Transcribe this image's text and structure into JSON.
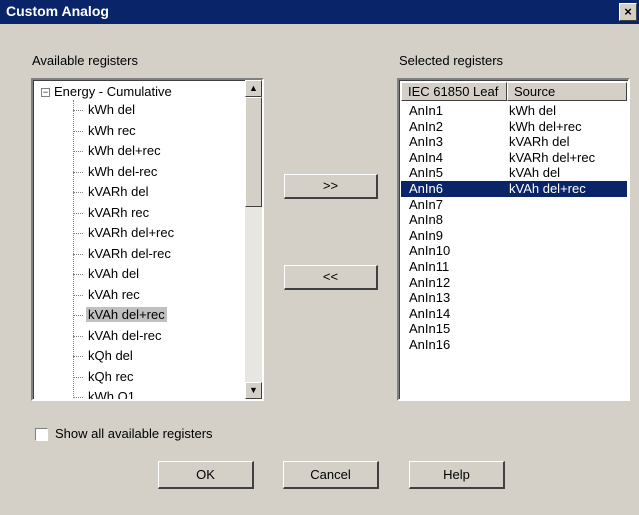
{
  "window": {
    "title": "Custom Analog",
    "close_label": "×"
  },
  "available": {
    "label": "Available registers",
    "root": {
      "expander": "−",
      "label": "Energy - Cumulative"
    },
    "items": [
      {
        "label": "kWh del"
      },
      {
        "label": "kWh rec"
      },
      {
        "label": "kWh del+rec"
      },
      {
        "label": "kWh del-rec"
      },
      {
        "label": "kVARh del"
      },
      {
        "label": "kVARh rec"
      },
      {
        "label": "kVARh del+rec"
      },
      {
        "label": "kVARh del-rec"
      },
      {
        "label": "kVAh del"
      },
      {
        "label": "kVAh rec"
      },
      {
        "label": "kVAh del+rec"
      },
      {
        "label": "kVAh del-rec"
      },
      {
        "label": "kQh del"
      },
      {
        "label": "kQh rec"
      },
      {
        "label": "kWh Q1"
      }
    ],
    "selected_item": "kVAh del+rec",
    "scroll_up": "▲",
    "scroll_down": "▼"
  },
  "buttons": {
    "add": ">>",
    "remove": "<<",
    "ok": "OK",
    "cancel": "Cancel",
    "help": "Help"
  },
  "selected": {
    "label": "Selected registers",
    "columns": [
      "IEC 61850 Leaf",
      "Source"
    ],
    "rows": [
      {
        "leaf": "AnIn1",
        "source": "kWh del"
      },
      {
        "leaf": "AnIn2",
        "source": "kWh del+rec"
      },
      {
        "leaf": "AnIn3",
        "source": "kVARh del"
      },
      {
        "leaf": "AnIn4",
        "source": "kVARh del+rec"
      },
      {
        "leaf": "AnIn5",
        "source": "kVAh del"
      },
      {
        "leaf": "AnIn6",
        "source": "kVAh del+rec"
      },
      {
        "leaf": "AnIn7",
        "source": ""
      },
      {
        "leaf": "AnIn8",
        "source": ""
      },
      {
        "leaf": "AnIn9",
        "source": ""
      },
      {
        "leaf": "AnIn10",
        "source": ""
      },
      {
        "leaf": "AnIn11",
        "source": ""
      },
      {
        "leaf": "AnIn12",
        "source": ""
      },
      {
        "leaf": "AnIn13",
        "source": ""
      },
      {
        "leaf": "AnIn14",
        "source": ""
      },
      {
        "leaf": "AnIn15",
        "source": ""
      },
      {
        "leaf": "AnIn16",
        "source": ""
      }
    ],
    "selected_leaf": "AnIn6"
  },
  "show_all": {
    "label": "Show all available registers",
    "checked": false
  },
  "colors": {
    "titlebar": "#0a246a",
    "dialog_bg": "#d4d0c8",
    "selection": "#0a246a"
  }
}
